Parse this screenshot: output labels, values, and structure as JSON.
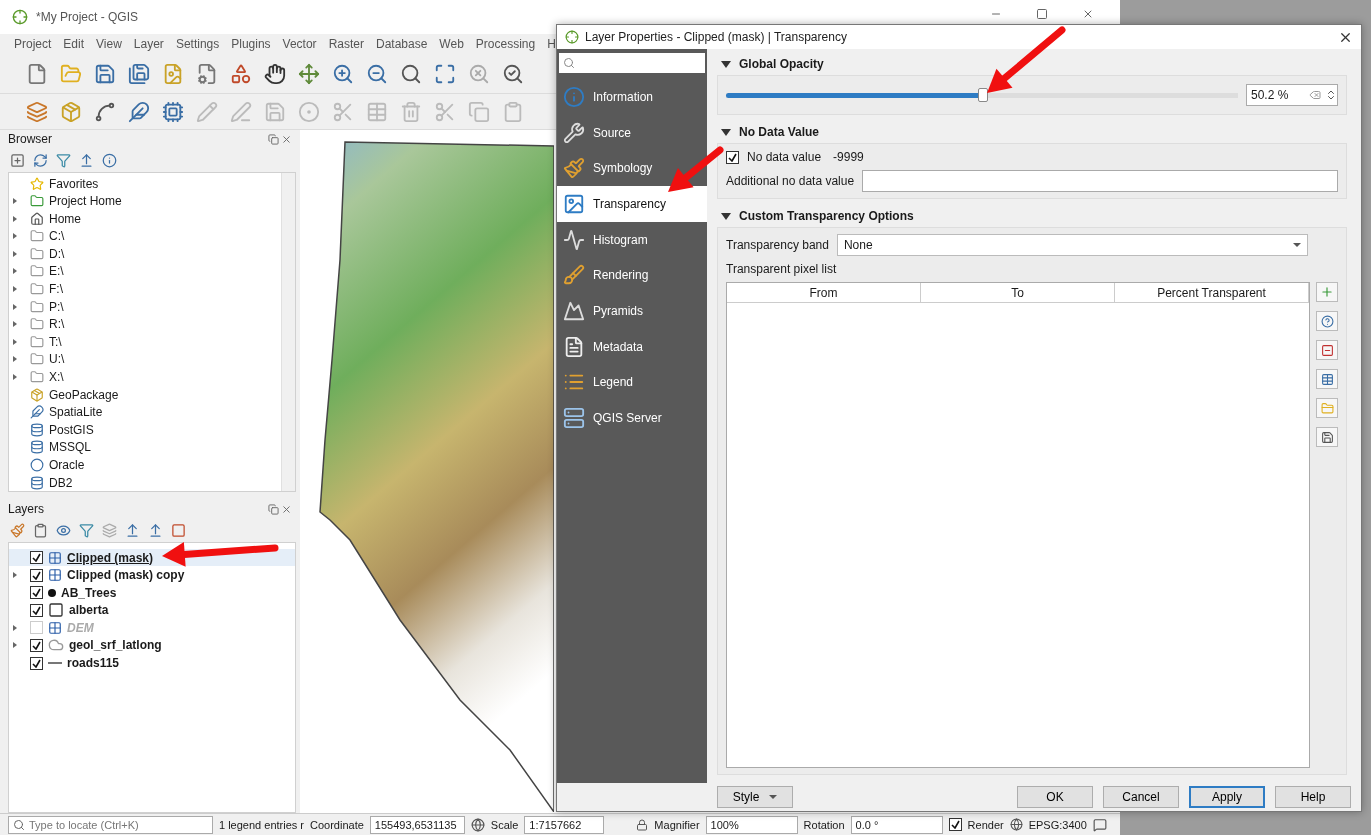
{
  "window": {
    "title": "*My Project - QGIS"
  },
  "menu": [
    "Project",
    "Edit",
    "View",
    "Layer",
    "Settings",
    "Plugins",
    "Vector",
    "Raster",
    "Database",
    "Web",
    "Processing",
    "H"
  ],
  "browser": {
    "title": "Browser",
    "items": [
      {
        "label": "Favorites",
        "kind": "favorites",
        "expandable": false
      },
      {
        "label": "Project Home",
        "kind": "project",
        "expandable": true
      },
      {
        "label": "Home",
        "kind": "home",
        "expandable": true
      },
      {
        "label": "C:\\",
        "kind": "drive",
        "expandable": true
      },
      {
        "label": "D:\\",
        "kind": "drive",
        "expandable": true
      },
      {
        "label": "E:\\",
        "kind": "drive",
        "expandable": true
      },
      {
        "label": "F:\\",
        "kind": "drive",
        "expandable": true
      },
      {
        "label": "P:\\",
        "kind": "drive",
        "expandable": true
      },
      {
        "label": "R:\\",
        "kind": "drive",
        "expandable": true
      },
      {
        "label": "T:\\",
        "kind": "drive",
        "expandable": true
      },
      {
        "label": "U:\\",
        "kind": "drive",
        "expandable": true
      },
      {
        "label": "X:\\",
        "kind": "drive",
        "expandable": true
      },
      {
        "label": "GeoPackage",
        "kind": "package",
        "expandable": false
      },
      {
        "label": "SpatiaLite",
        "kind": "feather",
        "expandable": false
      },
      {
        "label": "PostGIS",
        "kind": "database",
        "expandable": false
      },
      {
        "label": "MSSQL",
        "kind": "database",
        "expandable": false
      },
      {
        "label": "Oracle",
        "kind": "oval",
        "expandable": false
      },
      {
        "label": "DB2",
        "kind": "database",
        "expandable": false
      }
    ]
  },
  "layers": {
    "title": "Layers",
    "items": [
      {
        "label": "Clipped (mask)",
        "kind": "raster",
        "checked": true,
        "selected": true,
        "expandable": false,
        "disabled": false
      },
      {
        "label": "Clipped (mask) copy",
        "kind": "raster",
        "checked": true,
        "selected": false,
        "expandable": true,
        "disabled": false
      },
      {
        "label": "AB_Trees",
        "kind": "point",
        "checked": true,
        "selected": false,
        "expandable": false,
        "disabled": false
      },
      {
        "label": "alberta",
        "kind": "polygon",
        "checked": true,
        "selected": false,
        "expandable": false,
        "disabled": false
      },
      {
        "label": "DEM",
        "kind": "raster",
        "checked": false,
        "selected": false,
        "expandable": true,
        "disabled": true
      },
      {
        "label": "geol_srf_latlong",
        "kind": "blob",
        "checked": true,
        "selected": false,
        "expandable": true,
        "disabled": false
      },
      {
        "label": "roads115",
        "kind": "line",
        "checked": true,
        "selected": false,
        "expandable": false,
        "disabled": false
      }
    ]
  },
  "status_bar": {
    "locate_placeholder": "Type to locate (Ctrl+K)",
    "legend_message": "1 legend entries r",
    "coordinate_label": "Coordinate",
    "coordinate": "155493,6531135",
    "scale_label": "Scale",
    "scale": "1:7157662",
    "magnifier_label": "Magnifier",
    "magnifier": "100%",
    "rotation_label": "Rotation",
    "rotation": "0.0 °",
    "render": {
      "label": "Render",
      "checked": true
    },
    "crs": "EPSG:3400"
  },
  "dialog": {
    "title": "Layer Properties - Clipped (mask) | Transparency",
    "nav": [
      {
        "label": "Information",
        "kind": "information",
        "selected": false
      },
      {
        "label": "Source",
        "kind": "source",
        "selected": false
      },
      {
        "label": "Symbology",
        "kind": "symbology",
        "selected": false
      },
      {
        "label": "Transparency",
        "kind": "transparency",
        "selected": true
      },
      {
        "label": "Histogram",
        "kind": "histogram",
        "selected": false
      },
      {
        "label": "Rendering",
        "kind": "rendering",
        "selected": false
      },
      {
        "label": "Pyramids",
        "kind": "pyramids",
        "selected": false
      },
      {
        "label": "Metadata",
        "kind": "metadata",
        "selected": false
      },
      {
        "label": "Legend",
        "kind": "legend",
        "selected": false
      },
      {
        "label": "QGIS Server",
        "kind": "server",
        "selected": false
      }
    ],
    "global_opacity": {
      "title": "Global Opacity",
      "expanded": true,
      "level": 0.502,
      "value": "50.2 %"
    },
    "no_data": {
      "title": "No Data Value",
      "expanded": true,
      "checkbox": {
        "label": "No data value",
        "checked": true
      },
      "value": "-9999",
      "additional_label": "Additional no data value"
    },
    "custom": {
      "title": "Custom Transparency Options",
      "expanded": true,
      "band_label": "Transparency band",
      "band_value": "None",
      "list_label": "Transparent pixel list",
      "columns": [
        "From",
        "To",
        "Percent Transparent"
      ]
    },
    "style_button": "Style",
    "buttons": [
      {
        "label": "OK",
        "default": false
      },
      {
        "label": "Cancel",
        "default": false
      },
      {
        "label": "Apply",
        "default": true
      },
      {
        "label": "Help",
        "default": false
      }
    ]
  }
}
